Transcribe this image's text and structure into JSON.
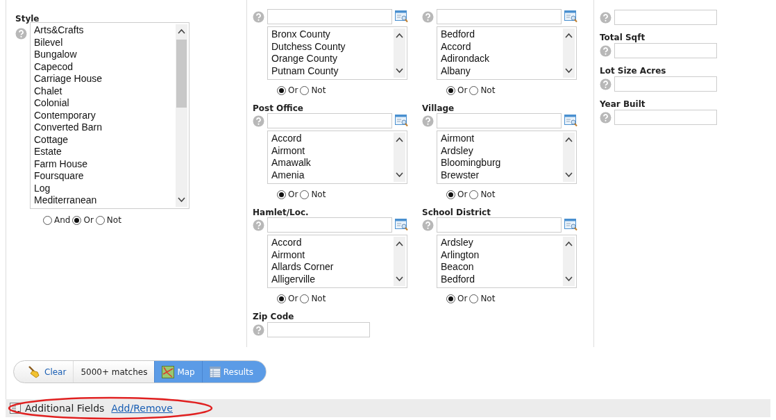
{
  "style": {
    "label": "Style",
    "options": [
      "Arts&Crafts",
      "Bilevel",
      "Bungalow",
      "Capecod",
      "Carriage House",
      "Chalet",
      "Colonial",
      "Contemporary",
      "Converted Barn",
      "Cottage",
      "Estate",
      "Farm House",
      "Foursquare",
      "Log",
      "Mediterranean"
    ],
    "radios": [
      {
        "label": "And",
        "selected": false
      },
      {
        "label": "Or",
        "selected": true
      },
      {
        "label": "Not",
        "selected": false
      }
    ]
  },
  "lookups": [
    {
      "options": [
        "Bronx County",
        "Dutchess County",
        "Orange County",
        "Putnam County"
      ],
      "radios": [
        {
          "label": "Or",
          "selected": true
        },
        {
          "label": "Not",
          "selected": false
        }
      ]
    },
    {
      "options": [
        "Bedford",
        "Accord",
        "Adirondack",
        "Albany"
      ],
      "radios": [
        {
          "label": "Or",
          "selected": true
        },
        {
          "label": "Not",
          "selected": false
        }
      ]
    },
    {
      "label": "Post Office",
      "options": [
        "Accord",
        "Airmont",
        "Amawalk",
        "Amenia"
      ],
      "radios": [
        {
          "label": "Or",
          "selected": true
        },
        {
          "label": "Not",
          "selected": false
        }
      ]
    },
    {
      "label": "Village",
      "options": [
        "Airmont",
        "Ardsley",
        "Bloomingburg",
        "Brewster"
      ],
      "radios": [
        {
          "label": "Or",
          "selected": true
        },
        {
          "label": "Not",
          "selected": false
        }
      ]
    },
    {
      "label": "Hamlet/Loc.",
      "options": [
        "Accord",
        "Airmont",
        "Allards Corner",
        "Alligerville"
      ],
      "radios": [
        {
          "label": "Or",
          "selected": true
        },
        {
          "label": "Not",
          "selected": false
        }
      ]
    },
    {
      "label": "School District",
      "options": [
        "Ardsley",
        "Arlington",
        "Beacon",
        "Bedford"
      ],
      "radios": [
        {
          "label": "Or",
          "selected": true
        },
        {
          "label": "Not",
          "selected": false
        }
      ]
    }
  ],
  "zip": {
    "label": "Zip Code"
  },
  "right_fields": [
    {
      "kind": "unlabeled"
    },
    {
      "kind": "labeled",
      "label": "Total Sqft"
    },
    {
      "kind": "labeled",
      "label": "Lot Size Acres"
    },
    {
      "kind": "labeled",
      "label": "Year Built"
    }
  ],
  "toolbar": [
    {
      "kind": "clear",
      "label": "Clear",
      "selected": false
    },
    {
      "kind": "count",
      "label": "5000+ matches",
      "selected": false
    },
    {
      "kind": "map",
      "label": "Map",
      "selected": true
    },
    {
      "kind": "results",
      "label": "Results",
      "selected": true
    }
  ],
  "footer": {
    "title": "Additional Fields",
    "link": "Add/Remove"
  }
}
